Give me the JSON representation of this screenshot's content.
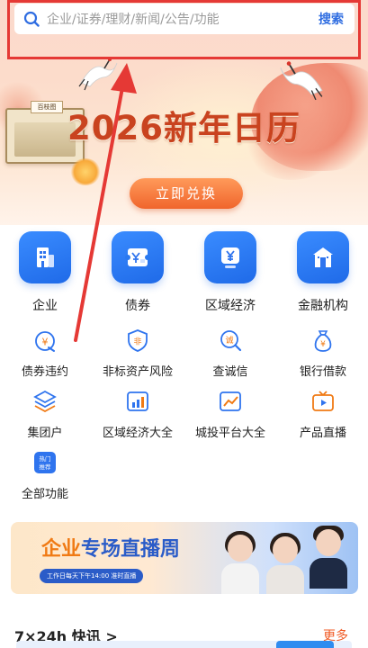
{
  "search": {
    "placeholder": "企业/证券/理财/新闻/公告/功能",
    "button_label": "搜索"
  },
  "banner": {
    "headline": "2026新年日历",
    "scroll_tag": "百枝图",
    "cta_label": "立即兑换"
  },
  "main_features": [
    {
      "label": "企业",
      "icon": "building-icon"
    },
    {
      "label": "债券",
      "icon": "bond-icon"
    },
    {
      "label": "区域经济",
      "icon": "yuan-icon"
    },
    {
      "label": "金融机构",
      "icon": "bank-icon"
    }
  ],
  "sub_features": [
    {
      "label": "债券违约",
      "icon": "coin-bag-icon",
      "glyph": "¥"
    },
    {
      "label": "非标资产风险",
      "icon": "shield-icon",
      "glyph": "非"
    },
    {
      "label": "查诚信",
      "icon": "magnifier-icon",
      "glyph": "诚"
    },
    {
      "label": "银行借款",
      "icon": "money-bag-icon",
      "glyph": "¥"
    },
    {
      "label": "集团户",
      "icon": "layers-icon",
      "glyph": ""
    },
    {
      "label": "区域经济大全",
      "icon": "bar-chart-icon",
      "glyph": ""
    },
    {
      "label": "城投平台大全",
      "icon": "line-chart-icon",
      "glyph": ""
    },
    {
      "label": "产品直播",
      "icon": "tv-icon",
      "glyph": ""
    },
    {
      "label": "全部功能",
      "icon": "hot-recommend-icon",
      "glyph": "热门推荐"
    }
  ],
  "live_banner": {
    "title_a": "企业",
    "title_b": "专场直播周",
    "subtitle": "工作日每天下午14:00  准时直播"
  },
  "bottom": {
    "title": "7×24h 快讯 >",
    "link": "更多"
  },
  "colors": {
    "brand_blue": "#2f6de1",
    "highlight_red": "#e53935",
    "cta_orange": "#f0652c"
  }
}
